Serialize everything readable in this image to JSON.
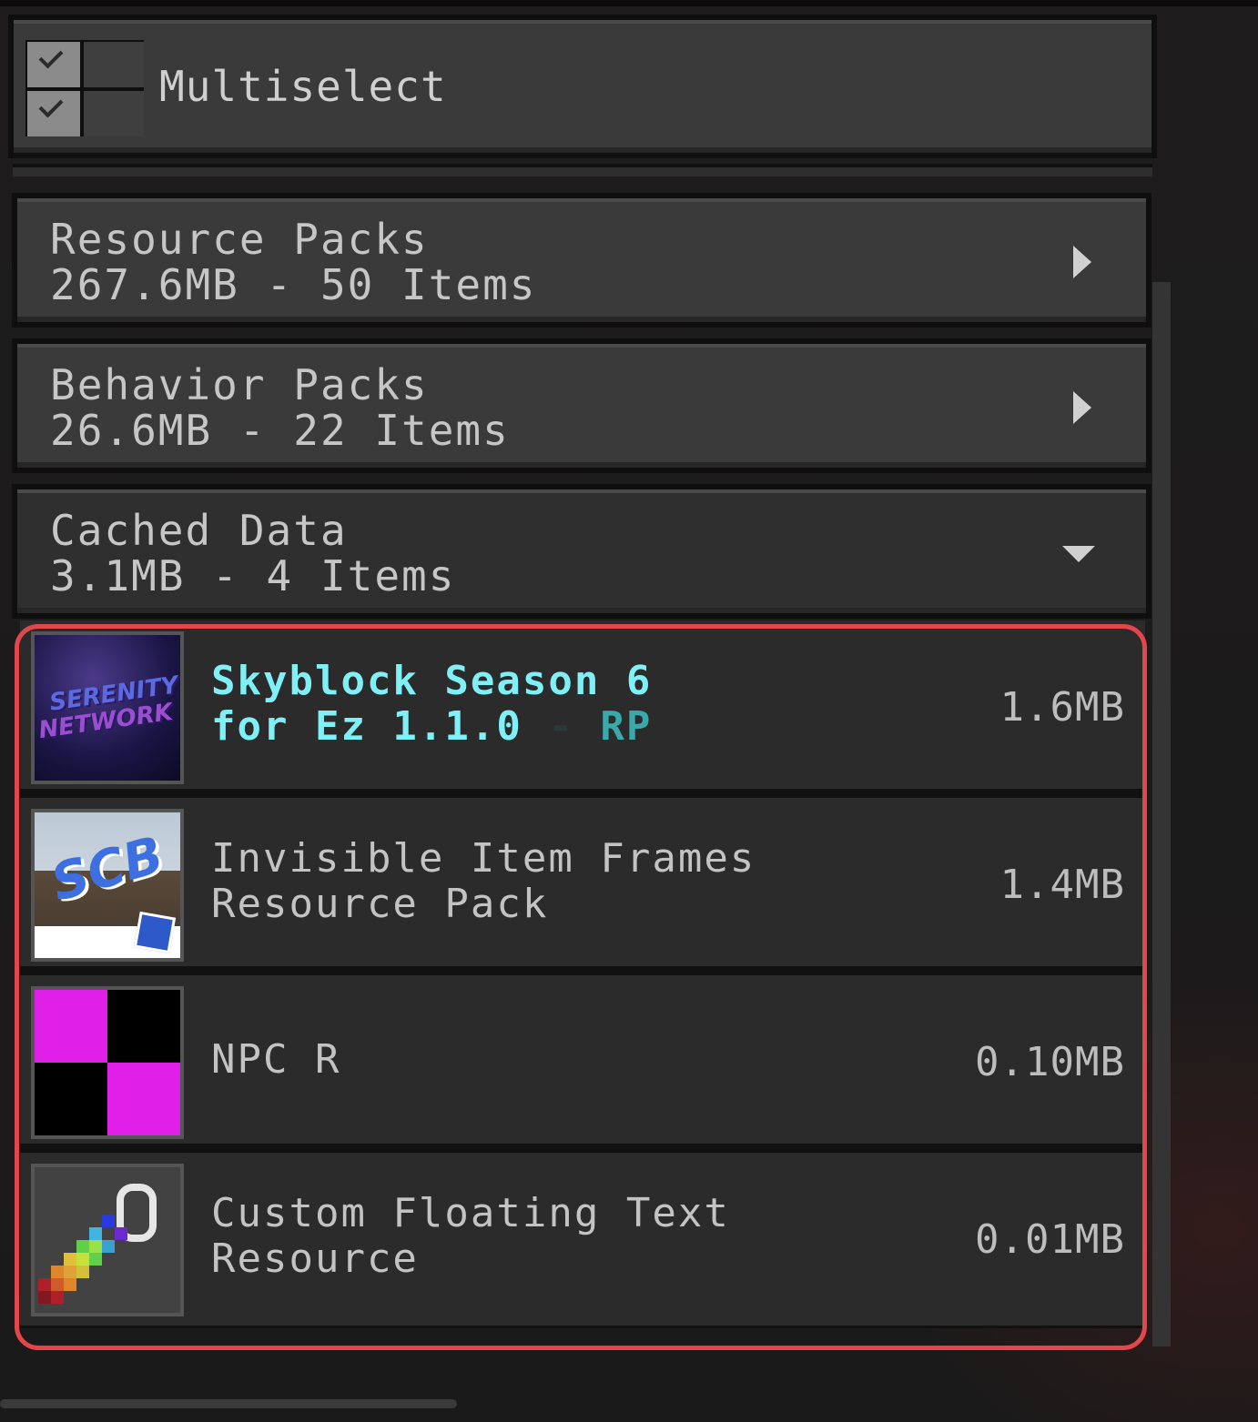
{
  "multiselect": {
    "label": "Multiselect"
  },
  "categories": [
    {
      "title": "Resource Packs",
      "subtitle": "267.6MB - 50 Items",
      "state": "collapsed"
    },
    {
      "title": "Behavior Packs",
      "subtitle": "26.6MB - 22 Items",
      "state": "collapsed"
    },
    {
      "title": "Cached Data",
      "subtitle": "3.1MB - 4 Items",
      "state": "expanded"
    }
  ],
  "cached_items": [
    {
      "title_line1": "Skyblock Season 6",
      "title_line2": "for Ez 1.1.0",
      "dash": "-",
      "tag": "RP",
      "size": "1.6MB",
      "thumb_text1": "SERENITY",
      "thumb_text2": "NETWORK"
    },
    {
      "title_line1": "Invisible Item Frames",
      "title_line2": "Resource Pack",
      "size": "1.4MB",
      "thumb_text": "SCB"
    },
    {
      "title_line1": "NPC R",
      "size": "0.10MB"
    },
    {
      "title_line1": "Custom Floating Text",
      "title_line2": "Resource",
      "size": "0.01MB"
    }
  ],
  "colors": {
    "highlight_title": "#7ff0f5",
    "rp_tag": "#39a9a9",
    "annotation": "#e4474b",
    "panel": "#3a3a3a"
  }
}
